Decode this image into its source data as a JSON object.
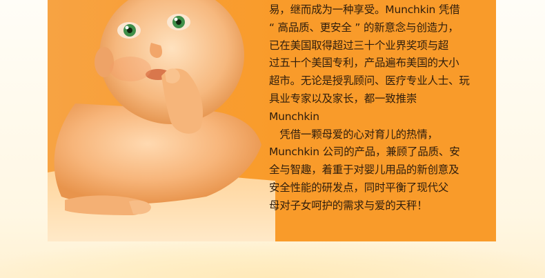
{
  "article": {
    "paragraph1_lines": [
      "易，继而成为一种享受。Munchkin 凭借",
      "“ 高品质、更安全 ” 的新意念与创造力，",
      "已在美国取得超过三十个业界奖项与超",
      "过五十个美国专利，产品遍布美国的大小",
      "超市。无论是授乳顾问、医疗专业人士、玩",
      "具业专家以及家长，都一致推崇",
      "Munchkin"
    ],
    "paragraph2_lines": [
      "　凭借一颗母爱的心对育儿的热情，",
      "Munchkin 公司的产品，兼顾了品质、安",
      "全与智趣，着重于对婴儿用品的新创意及",
      "安全性能的研发点，同时平衡了现代父",
      "母对子女呵护的需求与爱的天秤！"
    ]
  },
  "colors": {
    "panel": "#f99b2a",
    "text": "#2f1d0c",
    "page_background": "#fff7e3"
  }
}
